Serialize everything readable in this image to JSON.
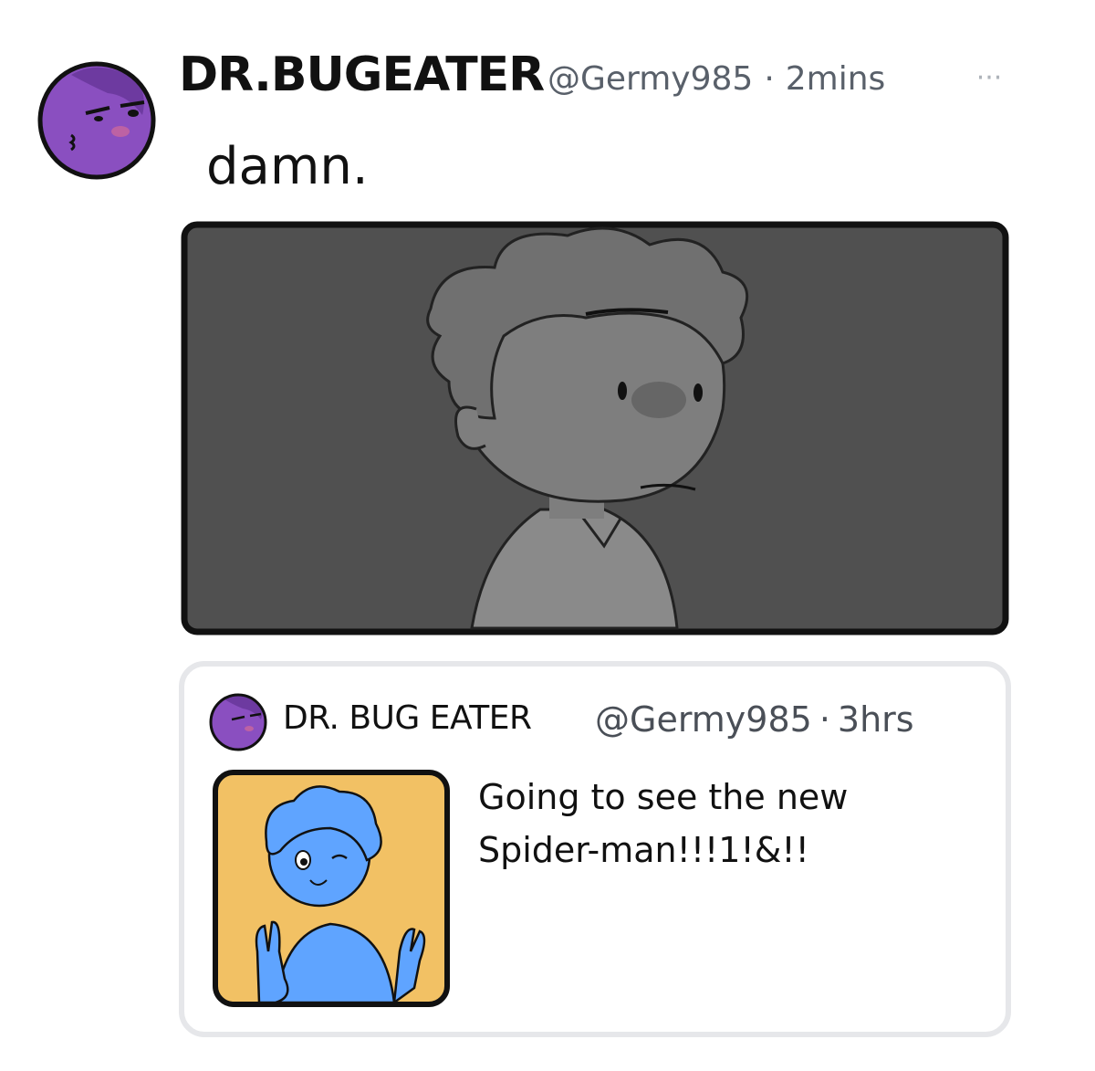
{
  "post": {
    "author_name": "DR.BUGEATER",
    "handle": "@Germy985",
    "separator": "·",
    "time": "2mins",
    "more_icon": "more-horizontal-icon",
    "text": "damn."
  },
  "quoted_post": {
    "author_name": "DR. BUG EATER",
    "handle": "@Germy985",
    "separator": "·",
    "time": "3hrs",
    "text_line1": "Going to see the new",
    "text_line2": "Spider-man!!!1!&!!"
  },
  "colors": {
    "avatar_purple": "#8a4fc0",
    "handle_gray": "#59606a",
    "image_dark": "#505050",
    "quote_image_yellow": "#f2c164",
    "quote_character_blue": "#5fa4ff",
    "card_border": "#e6e7ea"
  }
}
